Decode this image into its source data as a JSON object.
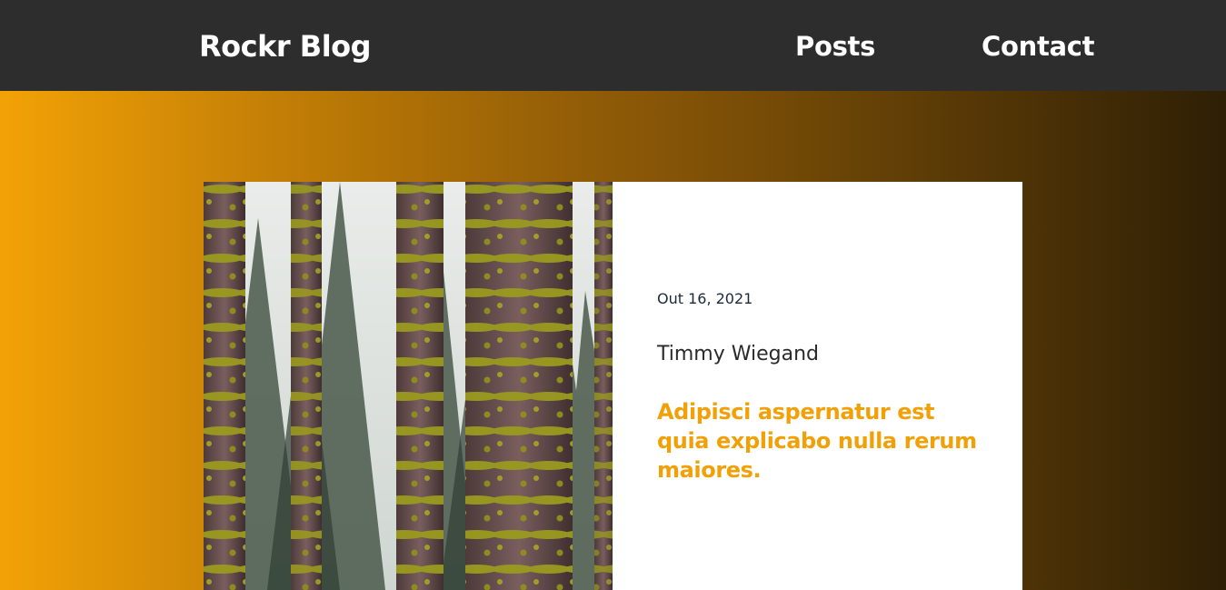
{
  "header": {
    "brand": "Rockr Blog",
    "nav": {
      "posts": "Posts",
      "contact": "Contact"
    }
  },
  "colors": {
    "header_bg": "#2d2d2d",
    "gradient_start": "#f3a206",
    "gradient_end": "#2e1f05",
    "accent": "#f2a007",
    "card_bg": "#ffffff"
  },
  "post": {
    "image_icon": "forest-photo",
    "date": "Out 16, 2021",
    "author": "Timmy Wiegand",
    "title": "Adipisci aspernatur est quia explicabo nulla rerum maiores."
  }
}
